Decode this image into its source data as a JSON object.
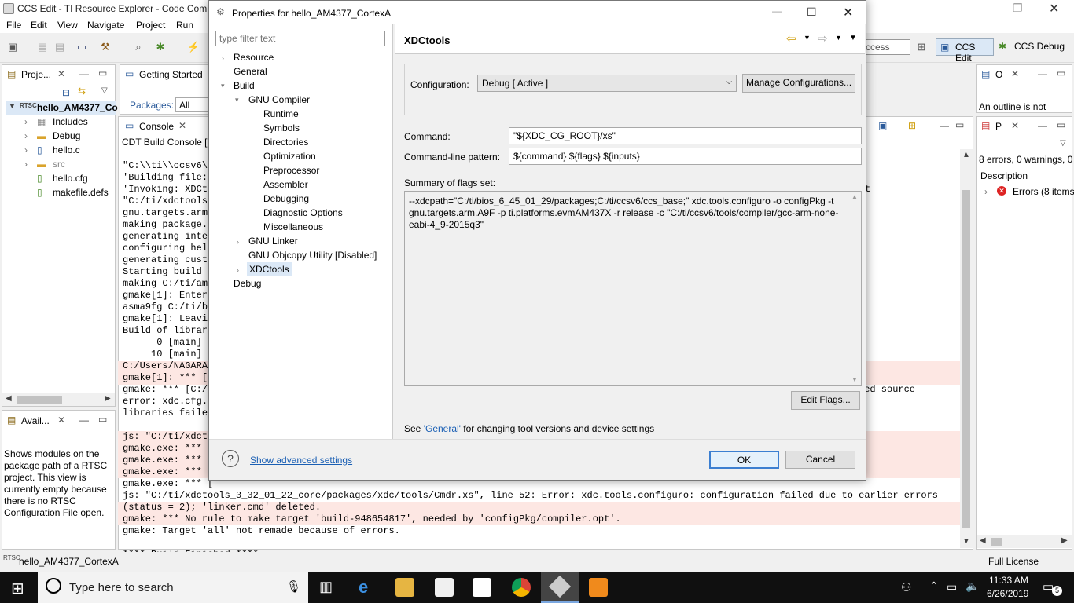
{
  "window": {
    "title": "CCS Edit - TI Resource Explorer - Code Compo"
  },
  "menu": [
    "File",
    "Edit",
    "View",
    "Navigate",
    "Project",
    "Run"
  ],
  "toolbar": {
    "search_fragment": "ccess",
    "perspective_edit": "CCS Edit",
    "perspective_debug": "CCS Debug"
  },
  "project_panel": {
    "tab": "Proje...",
    "project": "hello_AM4377_Co",
    "items": [
      "Includes",
      "Debug",
      "hello.c",
      "src",
      "hello.cfg",
      "makefile.defs"
    ]
  },
  "getting_started": {
    "tab": "Getting Started",
    "packages_label": "Packages:",
    "packages_value": "All"
  },
  "console": {
    "tab": "Console",
    "header": "CDT Build Console [h",
    "lines": [
      "\"C:\\\\ti\\\\ccsv6\\",
      "'Building file: ",
      "'Invoking: XDCto",
      "\"C:/ti/xdctools_",
      "gnu.targets.arm.",
      "making package.m",
      "generating inter",
      "configuring hell",
      "generating custo",
      "Starting build o",
      "making C:/ti/am4",
      "gmake[1]: Enteri",
      "asma9fg C:/ti/bi",
      "gmake[1]: Leavin",
      "Build of librari",
      "      0 [main] s",
      "     10 [main] s",
      "C:/Users/NAGARAJ",
      "gmake[1]: *** [a",
      "gmake: *** [C:/t",
      "error: xdc.cfg.S",
      "libraries failed",
      "",
      "js: \"C:/ti/xdcto",
      "gmake.exe: *** [",
      "gmake.exe: *** [",
      "gmake.exe: *** [",
      "gmake.exe: *** [",
      "js: \"C:/ti/xdctools_3_32_01_22_core/packages/xdc/tools/Cmdr.xs\", line 52: Error: xdc.tools.configuro: configuration failed due to earlier errors",
      "(status = 2); 'linker.cmd' deleted.",
      "gmake: *** No rule to make target 'build-948654817', needed by 'configPkg/compiler.opt'.",
      "gmake: Target 'all' not remade because of errors.",
      "",
      "**** Build Finished ****"
    ],
    "right_fragment_1": "t",
    "right_fragment_2": "ted source"
  },
  "available_panel": {
    "tab": "Avail...",
    "text": "Shows modules on the package path of a RTSC project. This view is currently empty because there is no RTSC Configuration File open."
  },
  "outline_panel": {
    "tab": "O",
    "text": "An outline is not"
  },
  "problems_panel": {
    "tab": "P",
    "summary": "8 errors, 0 warnings, 0",
    "col": "Description",
    "row": "Errors (8 items"
  },
  "status_bar": {
    "left": "hello_AM4377_CortexA",
    "right": "Full License"
  },
  "dialog": {
    "title": "Properties for hello_AM4377_CortexA",
    "filter_placeholder": "type filter text",
    "nav": {
      "resource": "Resource",
      "general": "General",
      "build": "Build",
      "gnu_compiler": "GNU Compiler",
      "compiler_children": [
        "Runtime",
        "Symbols",
        "Directories",
        "Optimization",
        "Preprocessor",
        "Assembler",
        "Debugging",
        "Diagnostic Options",
        "Miscellaneous"
      ],
      "gnu_linker": "GNU Linker",
      "objcopy": "GNU Objcopy Utility  [Disabled]",
      "xdctools": "XDCtools",
      "debug": "Debug"
    },
    "page_title": "XDCtools",
    "configuration_label": "Configuration:",
    "configuration_value": "Debug  [ Active ]",
    "manage_button": "Manage Configurations...",
    "command_label": "Command:",
    "command_value": "\"${XDC_CG_ROOT}/xs\"",
    "pattern_label": "Command-line pattern:",
    "pattern_value": "${command} ${flags} ${inputs}",
    "summary_label": "Summary of flags set:",
    "summary_text": "--xdcpath=\"C:/ti/bios_6_45_01_29/packages;C:/ti/ccsv6/ccs_base;\" xdc.tools.configuro -o configPkg -t gnu.targets.arm.A9F -p ti.platforms.evmAM437X -r release -c \"C:/ti/ccsv6/tools/compiler/gcc-arm-none-eabi-4_9-2015q3\"",
    "edit_flags": "Edit Flags...",
    "see_text_pre": "See ",
    "see_link": "'General'",
    "see_text_post": " for changing tool versions and device settings",
    "advanced_link": "Show advanced settings",
    "ok": "OK",
    "cancel": "Cancel"
  },
  "taskbar": {
    "search_placeholder": "Type here to search",
    "time": "11:33 AM",
    "date": "6/26/2019",
    "notifications": "5"
  }
}
